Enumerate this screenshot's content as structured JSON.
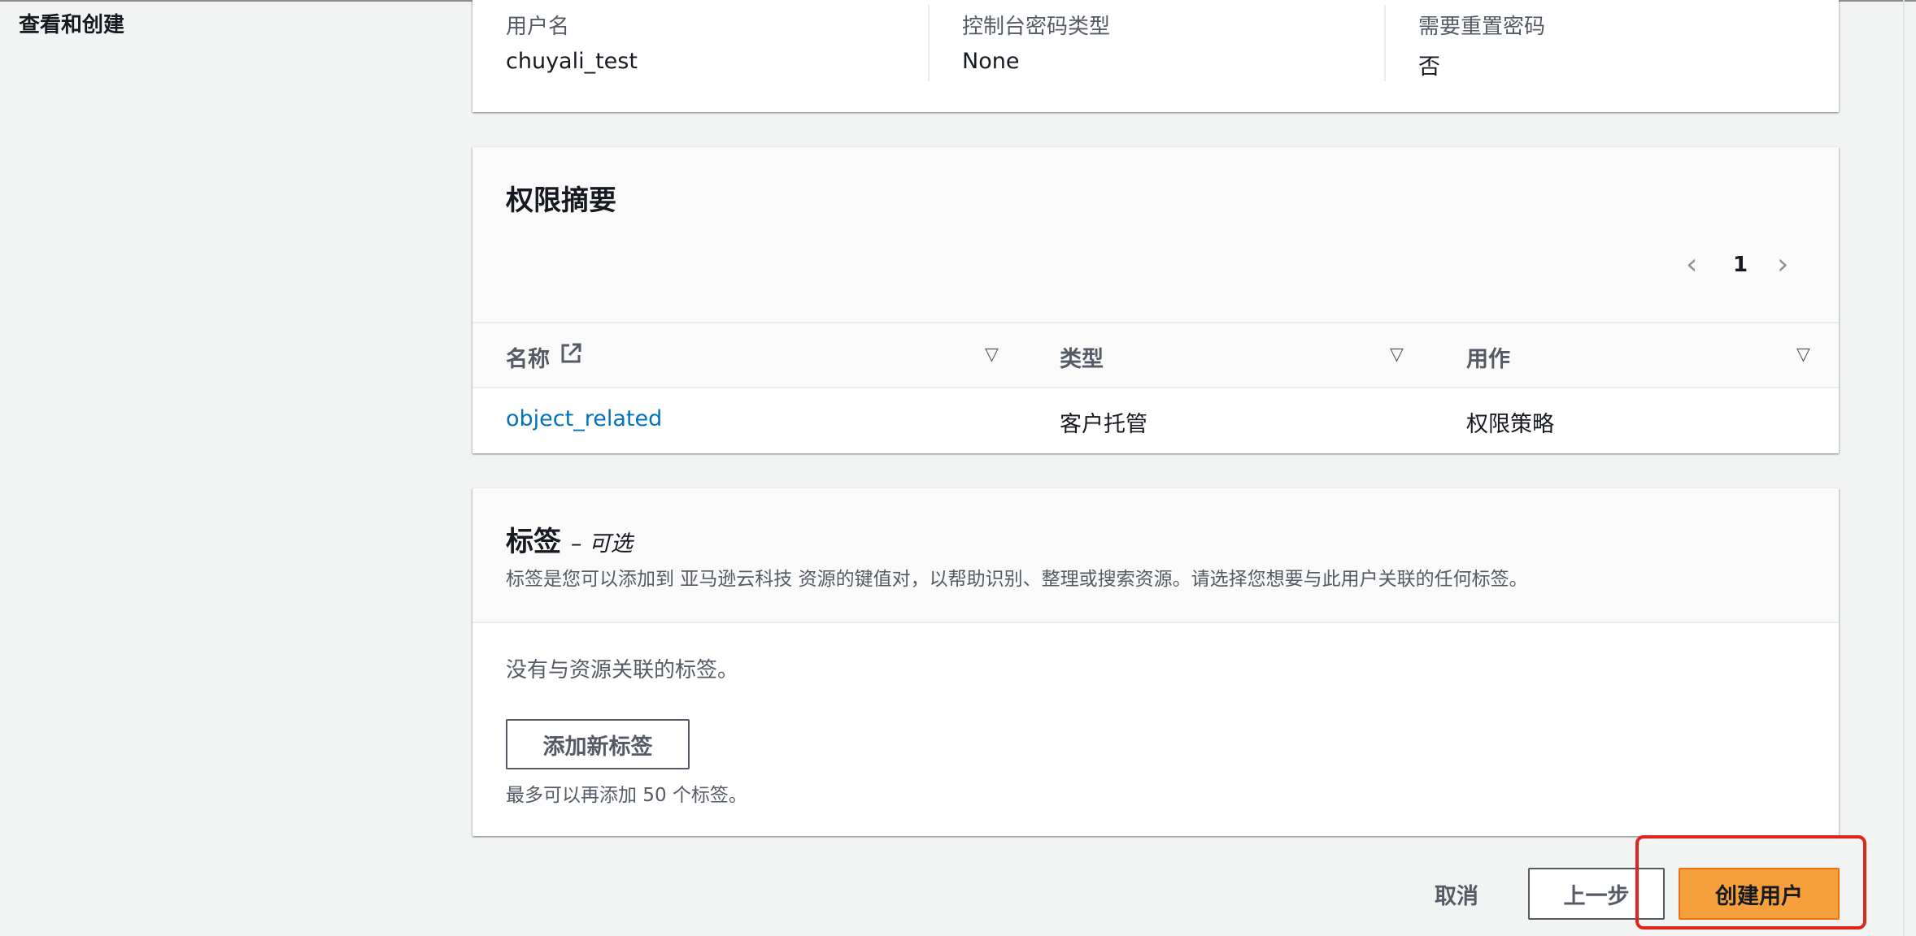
{
  "side": {
    "title": "查看和创建"
  },
  "user_details": {
    "columns": [
      {
        "key": "用户名",
        "value": "chuyali_test"
      },
      {
        "key": "控制台密码类型",
        "value": "None"
      },
      {
        "key": "需要重置密码",
        "value": "否"
      }
    ]
  },
  "permissions": {
    "title": "权限摘要",
    "pager": {
      "prev": "‹",
      "page": "1",
      "next": "›"
    },
    "headers": {
      "name": "名称",
      "type": "类型",
      "used_as": "用作"
    },
    "rows": [
      {
        "name": "object_related",
        "type": "客户托管",
        "used_as": "权限策略"
      }
    ]
  },
  "tags": {
    "title": "标签",
    "optional": "– 可选",
    "description": "标签是您可以添加到 亚马逊云科技 资源的键值对，以帮助识别、整理或搜索资源。请选择您想要与此用户关联的任何标签。",
    "empty": "没有与资源关联的标签。",
    "add_button": "添加新标签",
    "limit": "最多可以再添加 50 个标签。"
  },
  "footer": {
    "cancel": "取消",
    "previous": "上一步",
    "create": "创建用户"
  },
  "colors": {
    "primary": "#f5a03c",
    "link": "#0073bb",
    "highlight": "#e1251b"
  }
}
